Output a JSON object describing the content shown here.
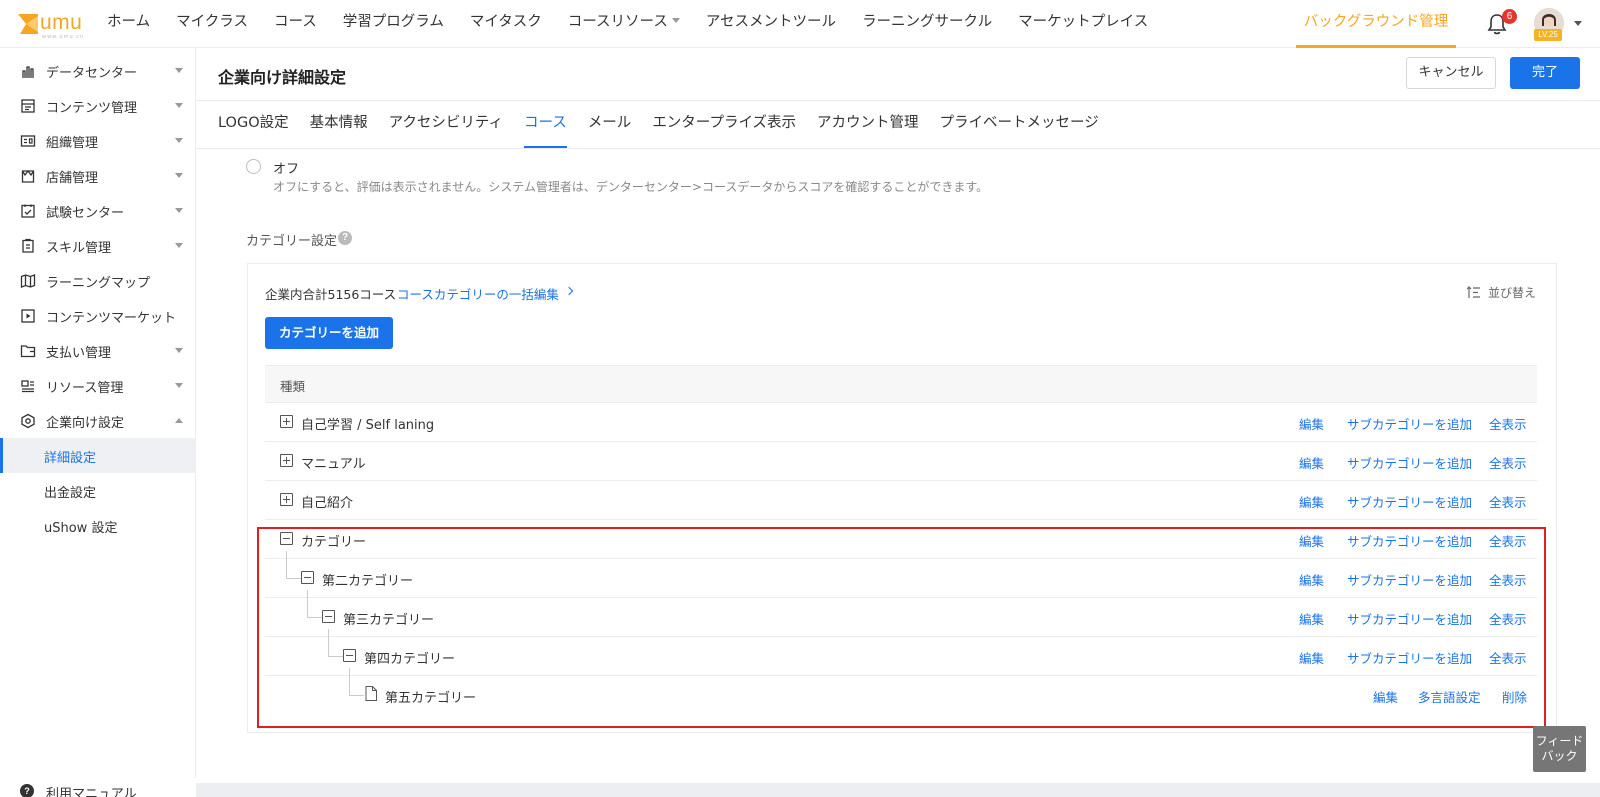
{
  "logo": {
    "text": "umu",
    "sub": "www.umu.cn"
  },
  "topnav": {
    "items": [
      "ホーム",
      "マイクラス",
      "コース",
      "学習プログラム",
      "マイタスク",
      "コースリソース",
      "アセスメントツール",
      "ラーニングサークル",
      "マーケットプレイス"
    ],
    "active": "バックグラウンド管理",
    "notification_count": "6",
    "level": "LV.25"
  },
  "sidebar": {
    "items": [
      {
        "label": "データセンター",
        "icon": "bar-chart-icon"
      },
      {
        "label": "コンテンツ管理",
        "icon": "content-icon"
      },
      {
        "label": "組織管理",
        "icon": "id-card-icon"
      },
      {
        "label": "店舗管理",
        "icon": "store-icon"
      },
      {
        "label": "試験センター",
        "icon": "exam-icon"
      },
      {
        "label": "スキル管理",
        "icon": "skill-icon"
      },
      {
        "label": "ラーニングマップ",
        "icon": "map-icon"
      },
      {
        "label": "コンテンツマーケット",
        "icon": "play-icon"
      },
      {
        "label": "支払い管理",
        "icon": "folder-icon"
      },
      {
        "label": "リソース管理",
        "icon": "resource-icon"
      },
      {
        "label": "企業向け設定",
        "icon": "settings-icon"
      }
    ],
    "subitems": [
      "詳細設定",
      "出金設定",
      "uShow 設定"
    ],
    "manual": "利用マニュアル"
  },
  "page": {
    "title": "企業向け詳細設定",
    "cancel": "キャンセル",
    "done": "完了"
  },
  "tabs": [
    "LOGO設定",
    "基本情報",
    "アクセシビリティ",
    "コース",
    "メール",
    "エンタープライズ表示",
    "アカウント管理",
    "プライベートメッセージ"
  ],
  "active_tab": "コース",
  "rating": {
    "off_label": "オフ",
    "off_desc": "オフにすると、評価は表示されません。システム管理者は、デンターセンター>コースデータからスコアを確認することができます。"
  },
  "category": {
    "label": "カテゴリー設定",
    "help": "?",
    "total": "企業内合計5156コース",
    "bulk_edit": "コースカテゴリーの一括編集",
    "sort": "並び替え",
    "add_button": "カテゴリーを追加",
    "column": "種類",
    "rows": [
      {
        "name": "自己学習 / Self laning",
        "actions": [
          "編集",
          "サブカテゴリーを追加",
          "全表示"
        ]
      },
      {
        "name": "マニュアル",
        "actions": [
          "編集",
          "サブカテゴリーを追加",
          "全表示"
        ]
      },
      {
        "name": "自己紹介",
        "actions": [
          "編集",
          "サブカテゴリーを追加",
          "全表示"
        ]
      },
      {
        "name": "カテゴリー",
        "actions": [
          "編集",
          "サブカテゴリーを追加",
          "全表示"
        ]
      },
      {
        "name": "第二カテゴリー",
        "actions": [
          "編集",
          "サブカテゴリーを追加",
          "全表示"
        ]
      },
      {
        "name": "第三カテゴリー",
        "actions": [
          "編集",
          "サブカテゴリーを追加",
          "全表示"
        ]
      },
      {
        "name": "第四カテゴリー",
        "actions": [
          "編集",
          "サブカテゴリーを追加",
          "全表示"
        ]
      },
      {
        "name": "第五カテゴリー",
        "actions": [
          "編集",
          "多言語設定",
          "削除"
        ]
      }
    ]
  },
  "feedback": "フィードバック",
  "colors": {
    "accent": "#1a73e8",
    "brand": "#f5a623",
    "highlight": "#e02020"
  }
}
